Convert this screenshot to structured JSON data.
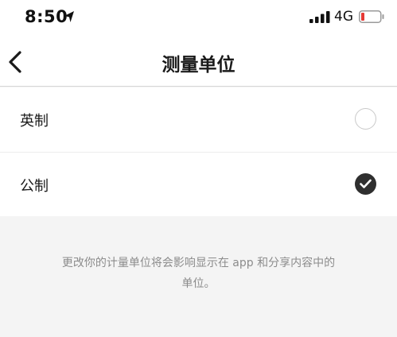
{
  "status_bar": {
    "time": "8:50",
    "network": "4G",
    "icons": [
      "location-arrow-icon",
      "cellular-signal-icon",
      "battery-low-icon"
    ],
    "battery_color": "#e53935"
  },
  "nav": {
    "back_icon": "chevron-left-icon",
    "title": "测量单位"
  },
  "options": [
    {
      "label": "英制",
      "selected": false
    },
    {
      "label": "公制",
      "selected": true
    }
  ],
  "footer": {
    "line1": "更改你的计量单位将会影响显示在 app 和分享内容中的",
    "line2": "单位。"
  },
  "colors": {
    "background": "#f4f4f4",
    "surface": "#ffffff",
    "check_fill": "#2f2f2f",
    "hint_text": "#8c8c8c"
  }
}
